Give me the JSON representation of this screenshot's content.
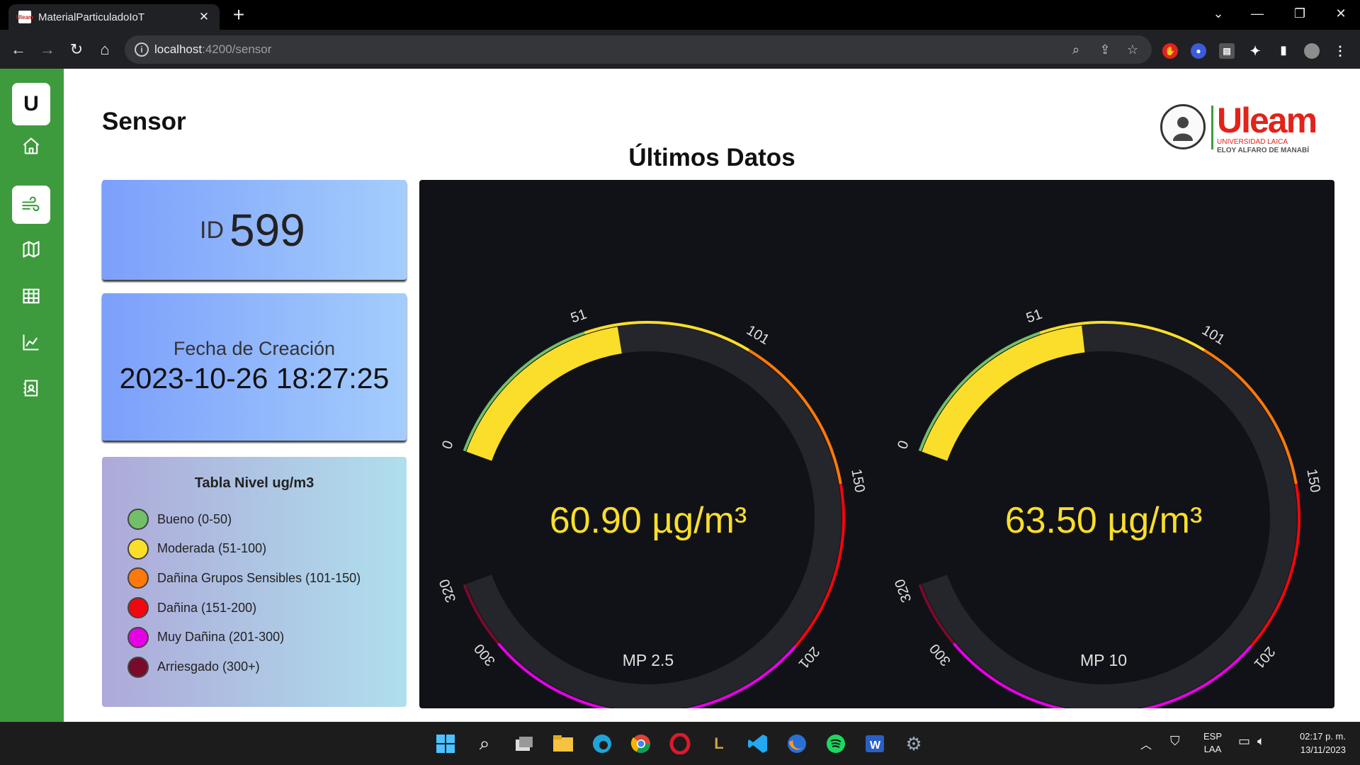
{
  "browser": {
    "tab_title": "MaterialParticuladoIoT",
    "tab_favicon_text": "Uleam",
    "url_host": "localhost",
    "url_rest": ":4200/sensor"
  },
  "sidebar": {
    "logo_letter": "U",
    "items": [
      {
        "icon": "home-icon"
      },
      {
        "icon": "wind-icon",
        "active": true
      },
      {
        "icon": "map-icon"
      },
      {
        "icon": "table-icon"
      },
      {
        "icon": "chart-icon"
      },
      {
        "icon": "contact-icon"
      }
    ]
  },
  "page": {
    "title": "Sensor",
    "section_title": "Últimos Datos"
  },
  "brand": {
    "name": "Uleam",
    "line1": "UNIVERSIDAD LAICA",
    "line2": "ELOY ALFARO DE MANABÍ"
  },
  "record": {
    "id_label": "ID",
    "id_value": "599",
    "date_label": "Fecha de Creación",
    "date_value": "2023-10-26 18:27:25"
  },
  "legend": {
    "title": "Tabla Nivel ug/m3",
    "items": [
      {
        "label": "Bueno (0-50)",
        "color": "#73bf69"
      },
      {
        "label": "Moderada (51-100)",
        "color": "#fade2a"
      },
      {
        "label": "Dañina Grupos Sensibles (101-150)",
        "color": "#ff780a"
      },
      {
        "label": "Dañina (151-200)",
        "color": "#f2060f"
      },
      {
        "label": "Muy Dañina (201-300)",
        "color": "#e600e6"
      },
      {
        "label": "Arriesgado (300+)",
        "color": "#7a0a2a"
      }
    ]
  },
  "gauges": {
    "min": 0,
    "max": 320,
    "thresholds": [
      {
        "from": 0,
        "to": 51,
        "color": "#73bf69"
      },
      {
        "from": 51,
        "to": 101,
        "color": "#fade2a"
      },
      {
        "from": 101,
        "to": 150,
        "color": "#ff780a"
      },
      {
        "from": 150,
        "to": 201,
        "color": "#f2060f"
      },
      {
        "from": 201,
        "to": 300,
        "color": "#e600e6"
      },
      {
        "from": 300,
        "to": 320,
        "color": "#7a0a2a"
      }
    ],
    "tick_labels": [
      "0",
      "51",
      "101",
      "150",
      "201",
      "300",
      "320"
    ],
    "value_color": "#fade2a",
    "track_color": "#25262b",
    "items": [
      {
        "name": "MP 2.5",
        "value": 60.9,
        "display": "60.90 µg/m³"
      },
      {
        "name": "MP 10",
        "value": 63.5,
        "display": "63.50 µg/m³"
      }
    ]
  },
  "taskbar": {
    "lang_top": "ESP",
    "lang_bottom": "LAA",
    "time": "02:17 p. m.",
    "date": "13/11/2023"
  }
}
